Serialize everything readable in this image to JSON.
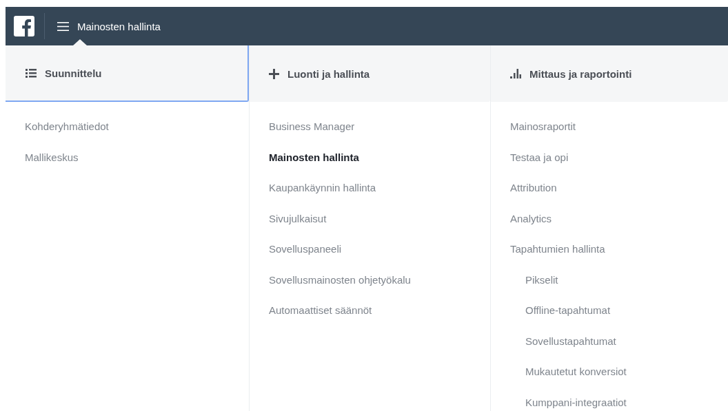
{
  "top_bar": {
    "title": "Mainosten hallinta"
  },
  "columns": [
    {
      "kind": "list",
      "title": "Suunnittelu",
      "selected": true,
      "items": [
        {
          "label": "Kohderyhmätiedot",
          "selected": false
        },
        {
          "label": "Mallikeskus",
          "selected": false
        }
      ]
    },
    {
      "kind": "plus",
      "title": "Luonti ja hallinta",
      "selected": false,
      "items": [
        {
          "label": "Business Manager",
          "selected": false
        },
        {
          "label": "Mainosten hallinta",
          "selected": true
        },
        {
          "label": "Kaupankäynnin hallinta",
          "selected": false
        },
        {
          "label": "Sivujulkaisut",
          "selected": false
        },
        {
          "label": "Sovelluspaneeli",
          "selected": false
        },
        {
          "label": "Sovellusmainosten ohjetyökalu",
          "selected": false
        },
        {
          "label": "Automaattiset säännöt",
          "selected": false
        }
      ]
    },
    {
      "kind": "bars",
      "title": "Mittaus ja raportointi",
      "selected": false,
      "items": [
        {
          "label": "Mainosraportit",
          "selected": false
        },
        {
          "label": "Testaa ja opi",
          "selected": false
        },
        {
          "label": "Attribution",
          "selected": false
        },
        {
          "label": "Analytics",
          "selected": false
        },
        {
          "label": "Tapahtumien hallinta",
          "selected": false,
          "children": [
            {
              "label": "Pikselit",
              "selected": false
            },
            {
              "label": "Offline-tapahtumat",
              "selected": false
            },
            {
              "label": "Sovellustapahtumat",
              "selected": false
            },
            {
              "label": "Mukautetut konversiot",
              "selected": false
            },
            {
              "label": "Kumppani-integraatiot",
              "selected": false
            }
          ]
        }
      ]
    }
  ]
}
